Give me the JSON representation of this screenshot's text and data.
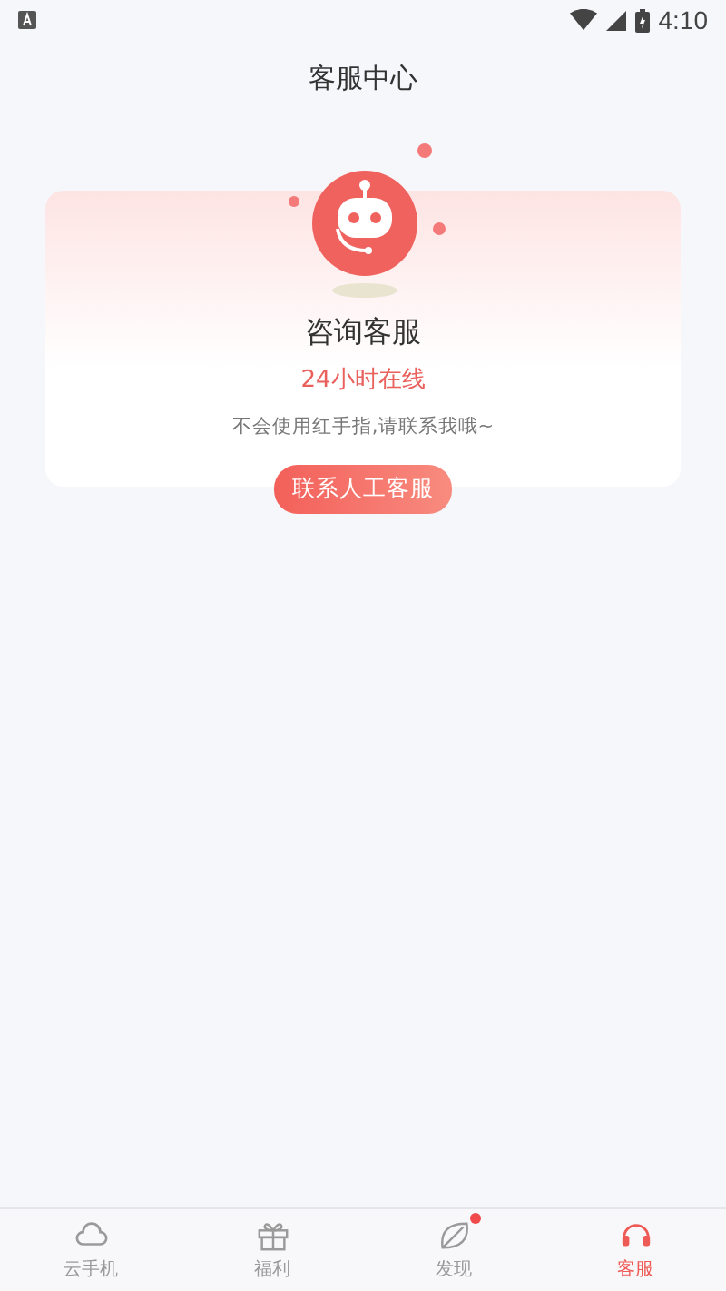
{
  "status_bar": {
    "time": "4:10"
  },
  "header": {
    "title": "客服中心"
  },
  "card": {
    "title": "咨询客服",
    "subtitle": "24小时在线",
    "description": "不会使用红手指,请联系我哦~",
    "button": "联系人工客服"
  },
  "tabs": [
    {
      "label": "云手机",
      "kind": "cloud",
      "selected": false,
      "badge": false
    },
    {
      "label": "福利",
      "kind": "gift",
      "selected": false,
      "badge": false
    },
    {
      "label": "发现",
      "kind": "leaf",
      "selected": false,
      "badge": true
    },
    {
      "label": "客服",
      "kind": "headset",
      "selected": true,
      "badge": false
    }
  ]
}
